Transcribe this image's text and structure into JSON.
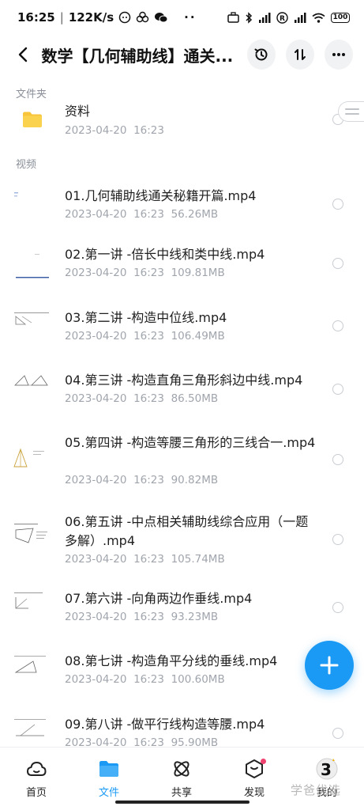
{
  "status": {
    "time": "16:25",
    "speed": "122K/s",
    "battery": "100"
  },
  "header": {
    "title": "数学【几何辅助线】通关..."
  },
  "sections": {
    "folders": "文件夹",
    "videos": "视频"
  },
  "folder": {
    "name": "资料",
    "date": "2023-04-20",
    "time": "16:23"
  },
  "videos": [
    {
      "title": "01.几何辅助线通关秘籍开篇.mp4",
      "date": "2023-04-20",
      "time": "16:23",
      "size": "56.26MB"
    },
    {
      "title": "02.第一讲 -倍长中线和类中线.mp4",
      "date": "2023-04-20",
      "time": "16:23",
      "size": "109.81MB"
    },
    {
      "title": "03.第二讲 -构造中位线.mp4",
      "date": "2023-04-20",
      "time": "16:23",
      "size": "106.49MB"
    },
    {
      "title": "04.第三讲 -构造直角三角形斜边中线.mp4",
      "date": "2023-04-20",
      "time": "16:23",
      "size": "86.50MB"
    },
    {
      "title": "05.第四讲 -构造等腰三角形的三线合一.mp4",
      "date": "2023-04-20",
      "time": "16:23",
      "size": "90.82MB"
    },
    {
      "title": "06.第五讲 -中点相关辅助线综合应用（一题多解）.mp4",
      "date": "2023-04-20",
      "time": "16:23",
      "size": "105.74MB"
    },
    {
      "title": "07.第六讲 -向角两边作垂线.mp4",
      "date": "2023-04-20",
      "time": "16:23",
      "size": "93.23MB"
    },
    {
      "title": "08.第七讲 -构造角平分线的垂线.mp4",
      "date": "2023-04-20",
      "time": "16:23",
      "size": "100.60MB"
    },
    {
      "title": "09.第八讲 -做平行线构造等腰.mp4",
      "date": "2023-04-20",
      "time": "16:23",
      "size": "95.90MB"
    }
  ],
  "nav": {
    "home": "首页",
    "files": "文件",
    "share": "共享",
    "discover": "发现",
    "mine": "我的",
    "mine_badge": "3"
  },
  "watermark": "学爸优选",
  "colors": {
    "accent": "#1b9af5",
    "folder": "#f8c43a",
    "badge": "#f0426e"
  }
}
